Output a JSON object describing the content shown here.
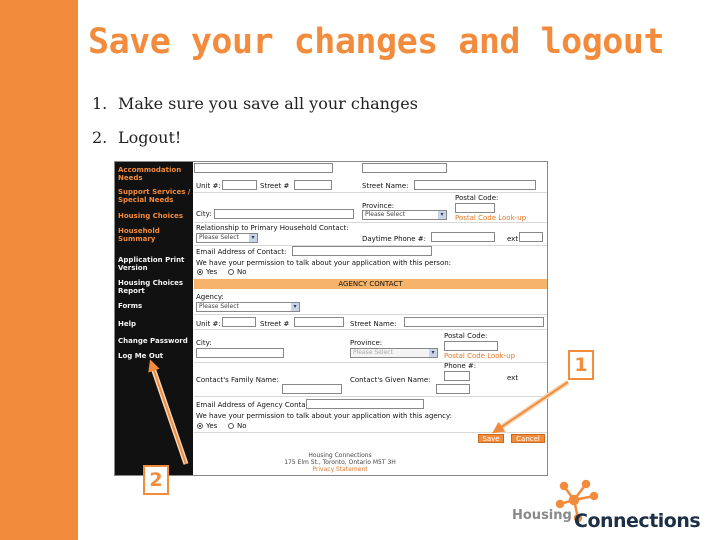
{
  "slide": {
    "title": "Save your changes and logout",
    "steps": [
      {
        "num": "1.",
        "text": "Make sure you save all your changes"
      },
      {
        "num": "2.",
        "text": "Logout!"
      }
    ],
    "callouts": [
      "1",
      "2"
    ]
  },
  "app_nav": {
    "items": [
      "Accommodation Needs",
      "Support Services / Special Needs",
      "Housing Choices",
      "Household Summary",
      "Application Print Version",
      "Housing Choices Report",
      "Forms",
      "Help",
      "Change Password",
      "Log Me Out"
    ]
  },
  "form": {
    "unit_label": "Unit #:",
    "street_num_label": "Street #",
    "street_name_label": "Street Name:",
    "postal_code_label": "Postal Code:",
    "city_label": "City:",
    "province_label": "Province:",
    "province_placeholder": "Please Select",
    "postal_lookup_label": "Postal Code Look-up",
    "relationship_label": "Relationship to Primary Household Contact:",
    "relationship_placeholder": "Please Select",
    "daytime_phone_label": "Daytime Phone #:",
    "ext_label": "ext",
    "email_label": "Email Address of Contact:",
    "permission_label": "We have your permission to talk about your application with this person:",
    "yes_label": "Yes",
    "no_label": "No",
    "agency_section": "AGENCY CONTACT",
    "agency_label": "Agency:",
    "agency_placeholder": "Please Select",
    "agency_unit_label": "Unit #:",
    "agency_street_num_label": "Street #",
    "agency_street_name_label": "Street Name:",
    "agency_city_label": "City:",
    "agency_postal_label": "Postal Code:",
    "agency_province_label": "Province:",
    "agency_province_placeholder": "Please Select",
    "agency_lookup_label": "Postal Code Look-up",
    "family_name_label": "Contact's Family Name:",
    "given_name_label": "Contact's Given Name:",
    "phone_label": "Phone #:",
    "agency_ext_label": "ext",
    "agency_email_label": "Email Address of Agency Contact:",
    "agency_permission_label": "We have your permission to talk about your application with this agency:",
    "agency_yes_label": "Yes",
    "agency_no_label": "No",
    "save_label": "Save",
    "cancel_label": "Cancel"
  },
  "footer": {
    "org": "Housing Connections",
    "address": "175 Elm St., Toronto, Ontario M5T 3H",
    "privacy": "Privacy Statement"
  },
  "logo": {
    "word_small": "Housing",
    "word_big": "Connections"
  },
  "colors": {
    "accent": "#f28b3c",
    "nav_bg": "#111111",
    "section_bar": "#f6b36a",
    "logo_text": "#1c2f44"
  }
}
